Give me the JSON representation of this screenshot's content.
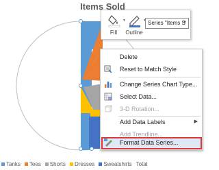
{
  "chart": {
    "title": "Items Sold",
    "legend": [
      {
        "label": "Tanks",
        "color": "#5b9bd5"
      },
      {
        "label": "Tees",
        "color": "#ed7d31"
      },
      {
        "label": "Shorts",
        "color": "#a5a5a5"
      },
      {
        "label": "Dresses",
        "color": "#ffc000"
      },
      {
        "label": "Sweatshirts",
        "color": "#4472c4"
      },
      {
        "label": "Total",
        "color": "#70ad47"
      }
    ]
  },
  "mini_toolbar": {
    "fill_label": "Fill",
    "outline_label": "Outline",
    "series_selector_value": "Series \"Items S"
  },
  "context_menu": {
    "items": [
      {
        "label": "Delete",
        "icon": "none",
        "enabled": true
      },
      {
        "label": "Reset to Match Style",
        "icon": "reset-style-icon",
        "enabled": true
      },
      {
        "label": "Change Series Chart Type...",
        "icon": "chart-type-icon",
        "enabled": true
      },
      {
        "label": "Select Data...",
        "icon": "select-data-icon",
        "enabled": true
      },
      {
        "label": "3-D Rotation...",
        "icon": "rotation-3d-icon",
        "enabled": false
      },
      {
        "label": "Add Data Labels",
        "icon": "none",
        "enabled": true,
        "submenu": true
      },
      {
        "label": "Add Trendline...",
        "icon": "none",
        "enabled": false
      },
      {
        "label": "Format Data Series...",
        "icon": "format-series-icon",
        "enabled": true,
        "highlighted": true
      }
    ]
  }
}
